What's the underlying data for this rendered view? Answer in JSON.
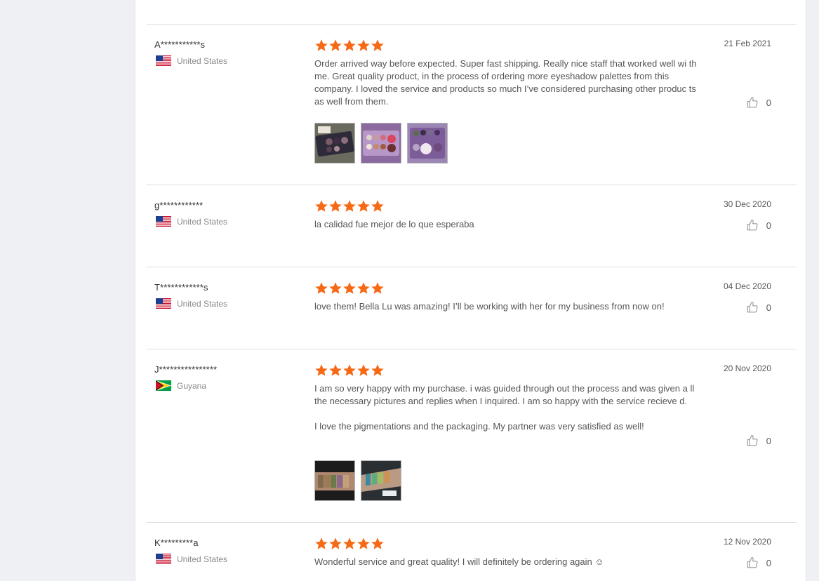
{
  "reviews": [
    {
      "user": "A***********s",
      "country": "United States",
      "flag": "us",
      "rating": 5,
      "text": [
        "Order arrived way before expected. Super fast shipping. Really nice staff that worked well wi th me. Great quality product, in the process of ordering more eyeshadow palettes from this company. I loved the service and products so much I’ve considered purchasing other produc ts as well from them."
      ],
      "date": "21 Feb 2021",
      "likes": "0",
      "photos": [
        "eyeshadow-palette-photo",
        "eyeshadow-palette-photo",
        "eyeshadow-palette-photo"
      ]
    },
    {
      "user": "g************",
      "country": "United States",
      "flag": "us",
      "rating": 5,
      "text": [
        "la calidad fue mejor de lo que esperaba"
      ],
      "date": "30 Dec 2020",
      "likes": "0",
      "photos": []
    },
    {
      "user": "T************s",
      "country": "United States",
      "flag": "us",
      "rating": 5,
      "text": [
        "love them! Bella Lu was amazing! I’ll be working with her for my business from now on!"
      ],
      "date": "04 Dec 2020",
      "likes": "0",
      "photos": []
    },
    {
      "user": "J****************",
      "country": "Guyana",
      "flag": "gy",
      "rating": 5,
      "text": [
        "I am so very happy with my purchase. i was guided through out the process and was given a ll the necessary pictures and replies when I inquired. I am so happy with the service recieve d.",
        "I love the pigmentations and the packaging. My partner was very satisfied as well!"
      ],
      "date": "20 Nov 2020",
      "likes": "0",
      "photos": [
        "arm-swatch-photo",
        "arm-swatch-photo"
      ]
    },
    {
      "user": "K*********a",
      "country": "United States",
      "flag": "us",
      "rating": 5,
      "text": [
        "Wonderful service and great quality! I will definitely be ordering again ☺"
      ],
      "date": "12 Nov 2020",
      "likes": "0",
      "photos": []
    }
  ],
  "colors": {
    "star": "#f66a16",
    "divider": "#d9dde3",
    "page_bg": "#eef0f4"
  }
}
